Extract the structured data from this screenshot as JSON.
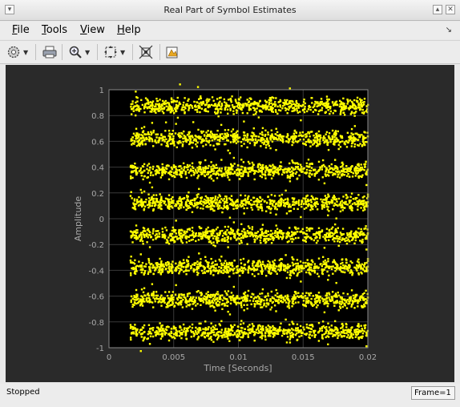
{
  "window": {
    "title": "Real Part of Symbol Estimates"
  },
  "menu": [
    {
      "label": "File",
      "mnemonic": "F",
      "rest": "ile"
    },
    {
      "label": "Tools",
      "mnemonic": "T",
      "rest": "ools"
    },
    {
      "label": "View",
      "mnemonic": "V",
      "rest": "iew"
    },
    {
      "label": "Help",
      "mnemonic": "H",
      "rest": "elp"
    }
  ],
  "toolbar": {
    "icons": [
      "gear-icon",
      "print-icon",
      "zoom-icon",
      "autoscale-icon",
      "pan-icon",
      "export-icon"
    ]
  },
  "status": {
    "text": "Stopped",
    "frame": "Frame=1"
  },
  "colors": {
    "plot_bg": "#000000",
    "figure_bg": "#2a2a2a",
    "marker": "#ffff00",
    "axes_text": "#a8a8a8"
  },
  "chart_data": {
    "type": "scatter",
    "title": "",
    "xlabel": "Time [Seconds]",
    "ylabel": "Amplitude",
    "xlim": [
      0,
      0.02
    ],
    "ylim": [
      -1,
      1
    ],
    "xticks": [
      "0",
      "0.005",
      "0.01",
      "0.015",
      "0.02"
    ],
    "yticks": [
      "-1",
      "-0.8",
      "-0.6",
      "-0.4",
      "-0.2",
      "0",
      "0.2",
      "0.4",
      "0.6",
      "0.8",
      "1"
    ],
    "grid": true,
    "data_start_x": 0.00165,
    "series": [
      {
        "levels": [
          0.875,
          0.625,
          0.375,
          0.125,
          -0.125,
          -0.375,
          -0.625,
          -0.875
        ],
        "spread": 0.03,
        "marker_color": "#ffff00"
      }
    ]
  }
}
